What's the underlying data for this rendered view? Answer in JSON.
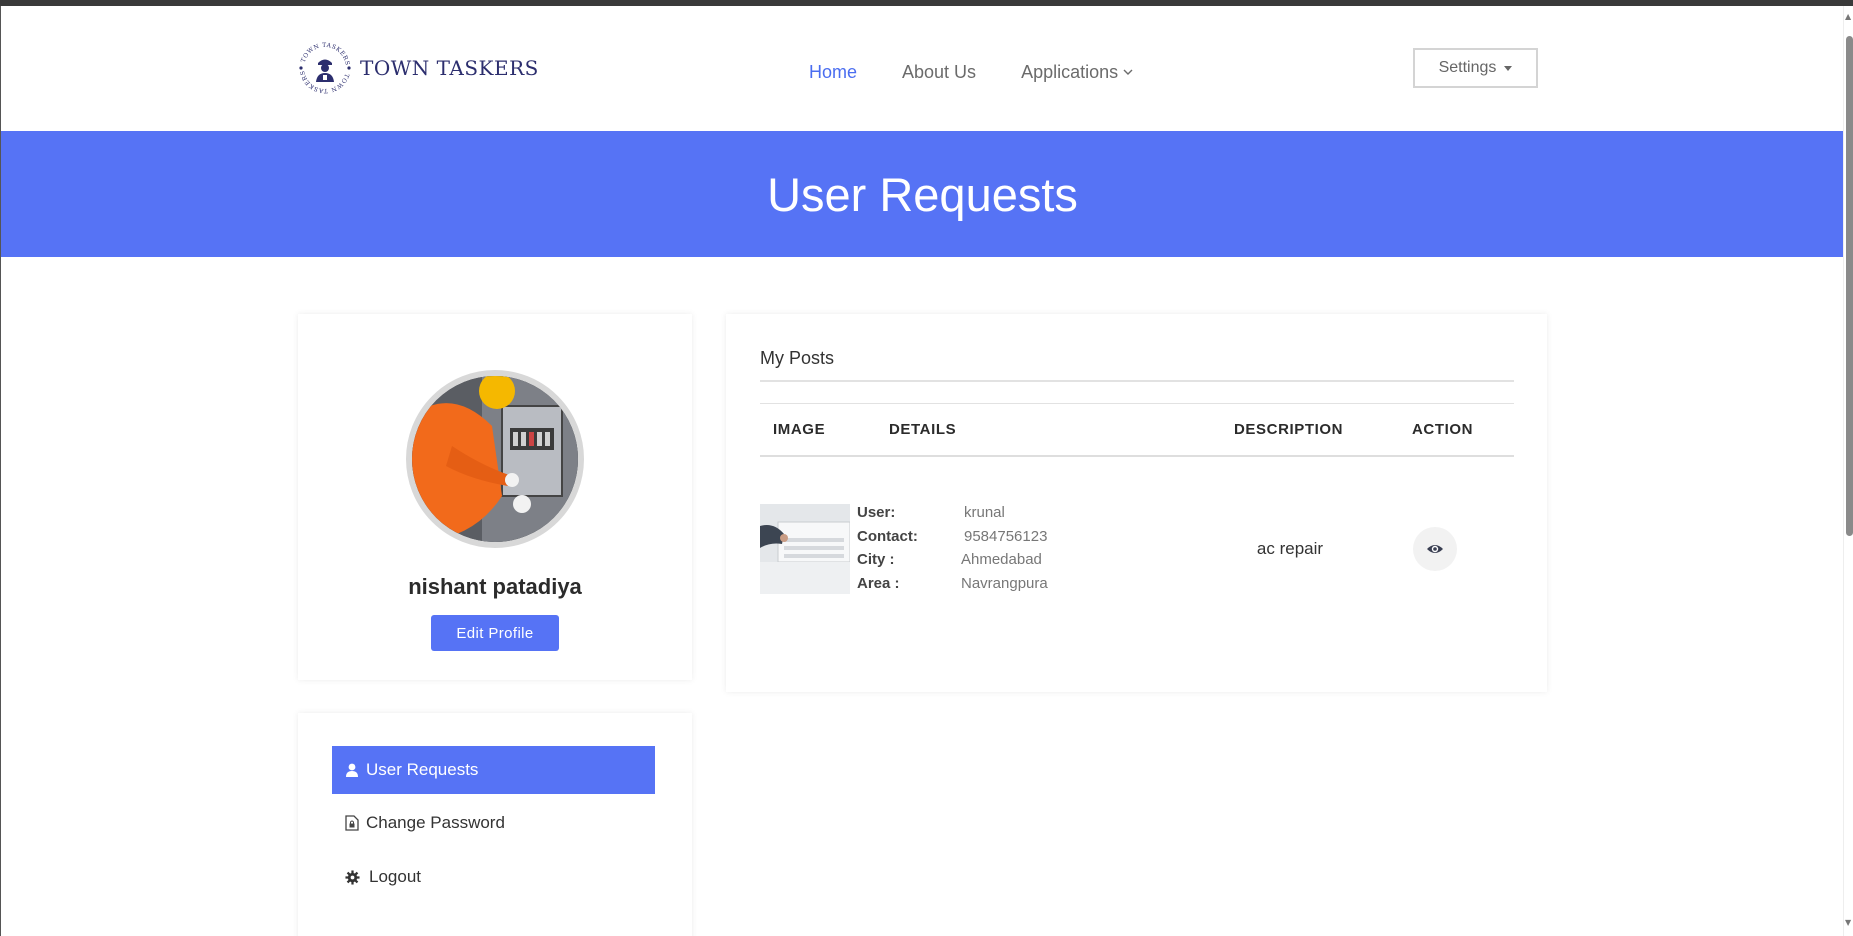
{
  "brand": {
    "name": "TOWN TASKERS",
    "logo_ring_text": "TOWN TASKERS"
  },
  "nav": {
    "home": "Home",
    "about": "About Us",
    "applications": "Applications",
    "settings": "Settings"
  },
  "banner": {
    "title": "User Requests"
  },
  "profile": {
    "name": "nishant patadiya",
    "edit_label": "Edit Profile"
  },
  "menu": {
    "items": [
      {
        "label": "User Requests",
        "icon": "user-icon",
        "active": true
      },
      {
        "label": "Change Password",
        "icon": "document-lock-icon",
        "active": false
      },
      {
        "label": "Logout",
        "icon": "gear-icon",
        "active": false
      }
    ]
  },
  "posts": {
    "title": "My Posts",
    "columns": [
      "IMAGE",
      "DETAILS",
      "DESCRIPTION",
      "ACTION"
    ],
    "rows": [
      {
        "user_label": "User:",
        "user": "krunal",
        "contact_label": "Contact:",
        "contact": "9584756123",
        "city_label": "City :",
        "city": "Ahmedabad",
        "area_label": "Area :",
        "area": "Navrangpura",
        "description": "ac repair",
        "action_icon": "eye-icon"
      }
    ]
  },
  "colors": {
    "accent": "#5673f5",
    "nav_active": "#4a6df0",
    "brand_text": "#2c2e6e"
  }
}
